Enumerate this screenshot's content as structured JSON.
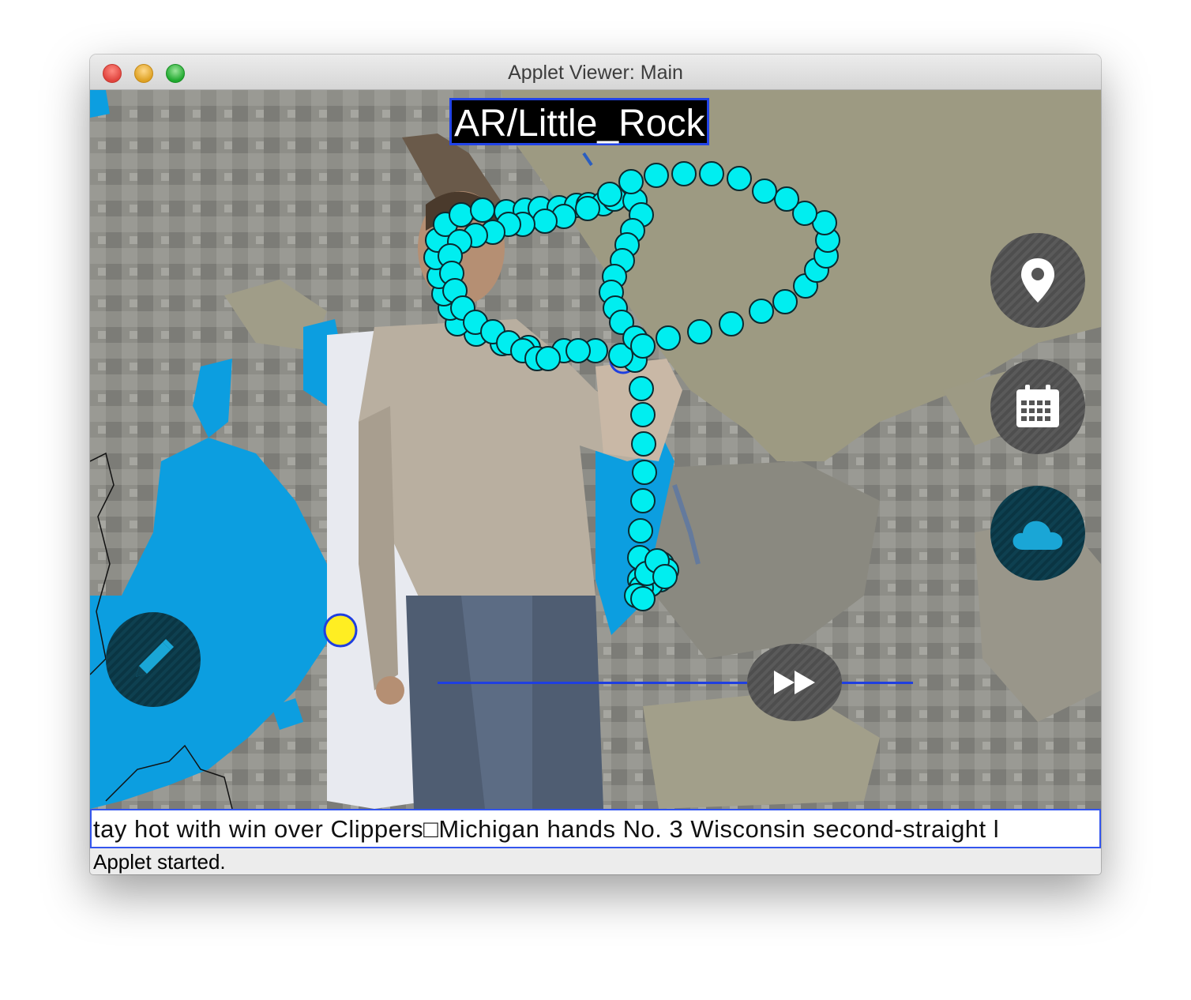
{
  "window": {
    "title": "Applet Viewer: Main"
  },
  "map": {
    "location_label": "AR/Little_Rock"
  },
  "controls": {
    "location_icon": "map-pin-icon",
    "calendar_icon": "calendar-icon",
    "weather_icon": "cloud-icon",
    "draw_icon": "pencil-icon",
    "playback_icon": "fast-forward-icon"
  },
  "ticker": {
    "text": "tay hot with win over Clippers□Michigan hands No. 3 Wisconsin second-straight l"
  },
  "status": {
    "text": "Applet started."
  },
  "colors": {
    "trail": "#00f0f0",
    "radar_rain": "#0c9ee0",
    "map_land": "#9b9a84",
    "selection_border": "#2244e8",
    "cursor_marker": "#ffee22"
  }
}
